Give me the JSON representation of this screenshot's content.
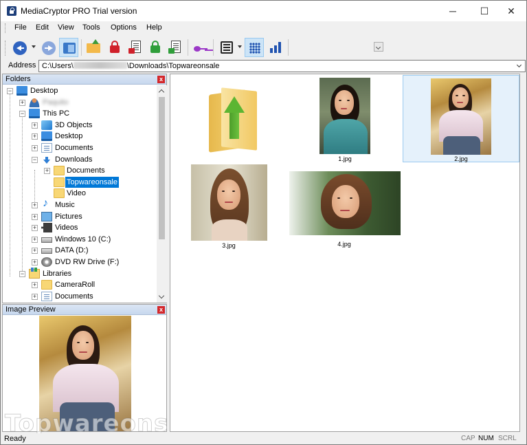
{
  "window": {
    "title": "MediaCryptor PRO Trial version",
    "minimize": "─",
    "maximize": "☐",
    "close": "✕"
  },
  "menu": [
    "File",
    "Edit",
    "View",
    "Tools",
    "Options",
    "Help"
  ],
  "address": {
    "label": "Address",
    "path_prefix": "C:\\Users\\",
    "path_suffix": "\\Downloads\\Topwareonsale"
  },
  "folders_panel": {
    "title": "Folders",
    "close": "x",
    "tree": [
      {
        "label": "Desktop",
        "icon": "monitor-icon",
        "expander": "−"
      },
      {
        "label": "Paquito",
        "icon": "user-icon",
        "expander": "+"
      },
      {
        "label": "This PC",
        "icon": "computer-icon",
        "expander": "−"
      },
      {
        "label": "3D Objects",
        "icon": "3d-objects-icon",
        "expander": "+"
      },
      {
        "label": "Desktop",
        "icon": "monitor-icon",
        "expander": "+"
      },
      {
        "label": "Documents",
        "icon": "documents-icon",
        "expander": "+"
      },
      {
        "label": "Downloads",
        "icon": "downloads-icon",
        "expander": "−"
      },
      {
        "label": "Documents",
        "icon": "folder-icon",
        "expander": "+"
      },
      {
        "label": "Topwareonsale",
        "icon": "folder-icon",
        "expander": ""
      },
      {
        "label": "Video",
        "icon": "folder-icon",
        "expander": ""
      },
      {
        "label": "Music",
        "icon": "music-icon",
        "expander": "+"
      },
      {
        "label": "Pictures",
        "icon": "pictures-icon",
        "expander": "+"
      },
      {
        "label": "Videos",
        "icon": "videos-icon",
        "expander": "+"
      },
      {
        "label": "Windows 10 (C:)",
        "icon": "drive-icon",
        "expander": "+"
      },
      {
        "label": "DATA (D:)",
        "icon": "drive-icon",
        "expander": "+"
      },
      {
        "label": "DVD RW Drive (F:)",
        "icon": "dvd-icon",
        "expander": "+"
      },
      {
        "label": "Libraries",
        "icon": "libraries-icon",
        "expander": "−"
      },
      {
        "label": "CameraRoll",
        "icon": "folder-icon",
        "expander": "+"
      },
      {
        "label": "Documents",
        "icon": "documents-icon",
        "expander": "+"
      }
    ],
    "selected": "Topwareonsale"
  },
  "preview_panel": {
    "title": "Image Preview",
    "close": "x",
    "watermark": "Topwareonsale"
  },
  "files": [
    {
      "name": "",
      "type": "parent-folder"
    },
    {
      "name": "1.jpg"
    },
    {
      "name": "2.jpg",
      "selected": true
    },
    {
      "name": "3.jpg"
    },
    {
      "name": "4.jpg"
    }
  ],
  "status": {
    "text": "Ready",
    "cap": "CAP",
    "num": "NUM",
    "scrl": "SCRL"
  },
  "colors": {
    "selection": "#0078d7",
    "thumb_selected_bg": "#e5f1fb",
    "panel_header": "#dbe6f4"
  }
}
